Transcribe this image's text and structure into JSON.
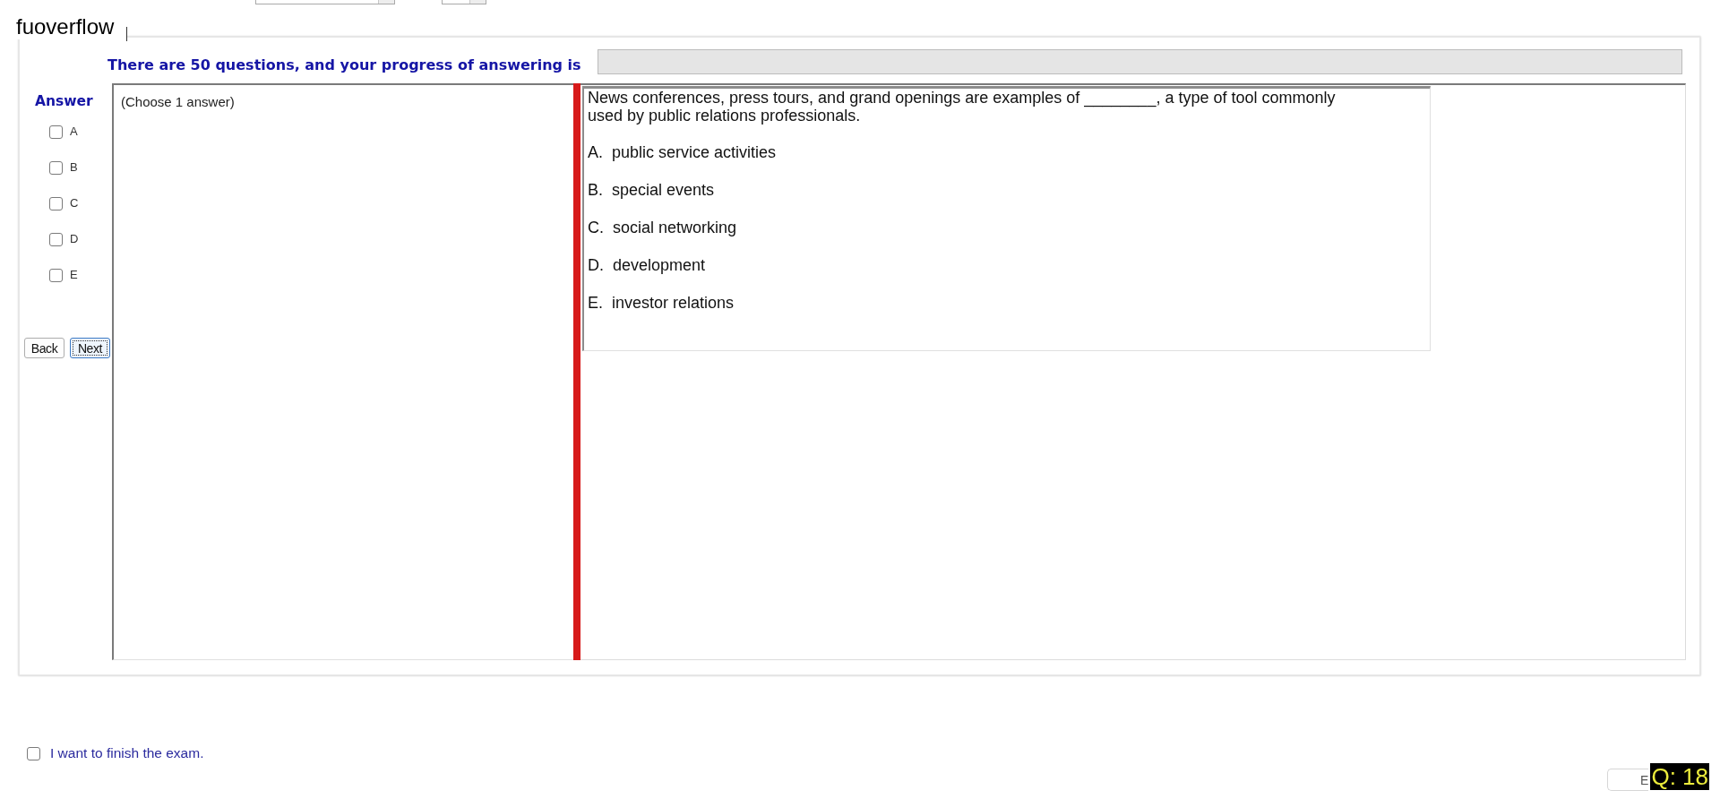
{
  "header": {
    "title": "fuoverflow"
  },
  "progress": {
    "label": "There are 50 questions, and your progress of answering is",
    "level": 0
  },
  "answer_panel": {
    "title": "Answer",
    "options": [
      {
        "label": "A",
        "checked": false
      },
      {
        "label": "B",
        "checked": false
      },
      {
        "label": "C",
        "checked": false
      },
      {
        "label": "D",
        "checked": false
      },
      {
        "label": "E",
        "checked": false
      }
    ],
    "buttons": [
      {
        "label": "Back",
        "focused": false
      },
      {
        "label": "Next",
        "focused": true
      }
    ]
  },
  "notes": {
    "text": "(Choose 1 answer)"
  },
  "question": {
    "text": "News conferences, press tours, and grand openings are examples of ________, a type of tool commonly used by public relations professionals.",
    "options": [
      "A.  public service activities",
      "B.  special events",
      "C.  social networking",
      "D.  development",
      "E.  investor relations"
    ]
  },
  "footer": {
    "finish": {
      "label": "I want to finish the exam.",
      "checked": false
    },
    "button": {
      "label": "E"
    },
    "badge": "Q: 18"
  }
}
